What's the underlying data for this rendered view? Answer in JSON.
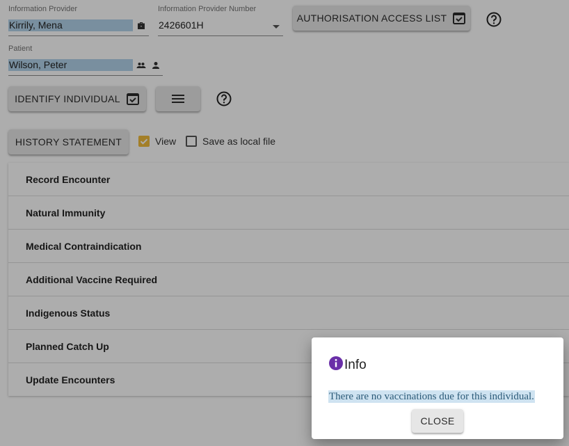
{
  "info_provider": {
    "label": "Information Provider",
    "value": "Kirrily, Mena",
    "icon": "briefcase-icon"
  },
  "info_provider_number": {
    "label": "Information Provider Number",
    "value": "2426601H",
    "icon": "dropdown-arrow-icon"
  },
  "authorisation_button": {
    "label": "AUTHORISATION ACCESS LIST",
    "icon": "calendar-check-icon"
  },
  "patient": {
    "label": "Patient",
    "value": "Wilson, Peter",
    "icons": [
      "people-icon",
      "person-icon"
    ]
  },
  "identify_button": {
    "label": "IDENTIFY INDIVIDUAL",
    "icon": "calendar-check-icon"
  },
  "menu_button": {
    "icon": "hamburger-menu-icon"
  },
  "history_button": {
    "label": "HISTORY STATEMENT"
  },
  "view_checkbox": {
    "label": "View",
    "checked": true
  },
  "save_checkbox": {
    "label": "Save as local file",
    "checked": false
  },
  "accordion": {
    "items": [
      "Record Encounter",
      "Natural Immunity",
      "Medical Contraindication",
      "Additional Vaccine Required",
      "Indigenous Status",
      "Planned Catch Up",
      "Update Encounters"
    ]
  },
  "dialog": {
    "title": "Info",
    "icon": "info-icon",
    "message": "There are no vaccinations due for this individual.",
    "close_label": "CLOSE"
  },
  "colors": {
    "accent_checkbox": "#f0bc3c",
    "info_icon": "#6a2fa8",
    "highlight": "#b3d3ea"
  }
}
